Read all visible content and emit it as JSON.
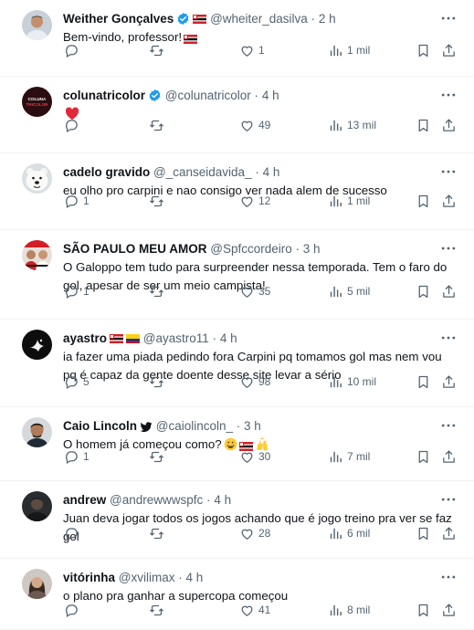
{
  "colors": {
    "text": "#0f1419",
    "muted": "#536471",
    "verified": "#1d9bf0",
    "divider": "#eff3f4",
    "like": "#f91880"
  },
  "tweets": [
    {
      "name": "Weither Gonçalves",
      "handle": "@wheiter_dasilva",
      "dot": "·",
      "time": "2 h",
      "badges": [
        "verified-badge",
        "flag-sao-paulo"
      ],
      "text": "Bem-vindo, professor!",
      "text_emoji": [
        "flag-sao-paulo"
      ],
      "replies": "",
      "retweets": "",
      "likes": "1",
      "views": "1 mil",
      "avatar": "photo-man"
    },
    {
      "name": "colunatricolor",
      "handle": "@colunatricolor",
      "dot": "·",
      "time": "4 h",
      "badges": [
        "verified-badge"
      ],
      "text": "",
      "text_emoji": [
        "red-heart"
      ],
      "replies": "",
      "retweets": "",
      "likes": "49",
      "views": "13 mil",
      "avatar": "logo-colunatricolor",
      "avatar_text": "COLUNA TRICOLOR"
    },
    {
      "name": "cadelo gravido",
      "handle": "@_canseidavida_",
      "dot": "·",
      "time": "4 h",
      "badges": [],
      "text": "eu olho pro carpini e nao consigo ver nada alem de sucesso",
      "text_emoji": [],
      "replies": "1",
      "retweets": "",
      "likes": "12",
      "views": "1 mil",
      "avatar": "polar-bear"
    },
    {
      "name": "SÃO PAULO MEU AMOR",
      "handle": "@Spfccordeiro",
      "dot": "·",
      "time": "3 h",
      "badges": [],
      "text": "O Galoppo tem tudo para surpreender nessa temporada. Tem o faro do gol, apesar de ser um meio campista!",
      "text_emoji": [],
      "replies": "1",
      "retweets": "",
      "likes": "35",
      "views": "5 mil",
      "avatar": "photo-crowd"
    },
    {
      "name": "ayastro",
      "handle": "@ayastro11",
      "dot": "·",
      "time": "4 h",
      "badges": [
        "flag-sao-paulo",
        "flag-colombia"
      ],
      "text": "ia fazer uma piada pedindo fora Carpini pq tomamos gol mas nem vou pq é capaz da gente doente desse site levar a sério",
      "text_emoji": [],
      "replies": "5",
      "retweets": "",
      "likes": "98",
      "views": "10 mil",
      "avatar": "dark-dove"
    },
    {
      "name": "Caio Lincoln",
      "handle": "@caiolincoln_",
      "dot": "·",
      "time": "3 h",
      "badges": [
        "bird-icon"
      ],
      "text": "O homem já começou como?",
      "text_emoji": [
        "grinning-face",
        "flag-sao-paulo",
        "raising-hands"
      ],
      "replies": "1",
      "retweets": "",
      "likes": "30",
      "views": "7 mil",
      "avatar": "photo-man-beard"
    },
    {
      "name": "andrew",
      "handle": "@andrewwwspfc",
      "dot": "·",
      "time": "4 h",
      "badges": [],
      "text": "Juan deva jogar todos os jogos achando que é jogo treino pra ver se faz gol",
      "text_emoji": [],
      "replies": "",
      "retweets": "",
      "likes": "28",
      "views": "6 mil",
      "avatar": "photo-dark"
    },
    {
      "name": "vitórinha",
      "handle": "@xvilimax",
      "dot": "·",
      "time": "4 h",
      "badges": [],
      "text": "o plano pra ganhar a supercopa começou",
      "text_emoji": [],
      "replies": "",
      "retweets": "",
      "likes": "41",
      "views": "8 mil",
      "avatar": "photo-woman"
    }
  ]
}
